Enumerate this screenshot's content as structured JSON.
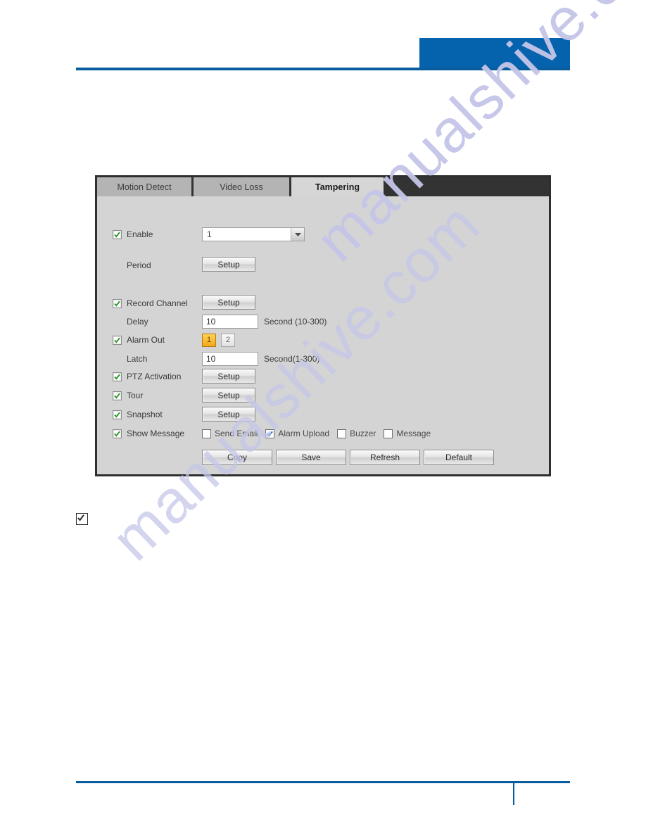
{
  "watermark": {
    "text": "manualshive.com"
  },
  "header": {
    "blue_block_color": "#0563ad",
    "rule_color": "#0a5d9c"
  },
  "footer": {
    "rule_color": "#0a5d9c"
  },
  "note": {
    "checkbox_icon": "checked-box-icon",
    "checked": true
  },
  "panel": {
    "background_color": "#d4d4d4",
    "border_color": "#2e2e2e",
    "tabs": [
      {
        "label": "Motion Detect",
        "active": false
      },
      {
        "label": "Video Loss",
        "active": false
      },
      {
        "label": "Tampering",
        "active": true
      }
    ],
    "rows": {
      "enable": {
        "label": "Enable",
        "checked": true,
        "select_value": "1",
        "select_arrow_icon": "chevron-down-icon"
      },
      "period": {
        "label": "Period",
        "button_label": "Setup"
      },
      "record_channel": {
        "label": "Record Channel",
        "checked": true,
        "button_label": "Setup"
      },
      "delay": {
        "label": "Delay",
        "value": "10",
        "unit": "Second (10-300)"
      },
      "alarm_out": {
        "label": "Alarm Out",
        "checked": true,
        "options": [
          {
            "label": "1",
            "selected": true
          },
          {
            "label": "2",
            "selected": false
          }
        ]
      },
      "latch": {
        "label": "Latch",
        "value": "10",
        "unit": "Second(1-300)"
      },
      "ptz_activation": {
        "label": "PTZ Activation",
        "checked": true,
        "button_label": "Setup"
      },
      "tour": {
        "label": "Tour",
        "checked": true,
        "button_label": "Setup"
      },
      "snapshot": {
        "label": "Snapshot",
        "checked": true,
        "button_label": "Setup"
      },
      "show_message": {
        "label": "Show Message",
        "checked": true,
        "options": [
          {
            "label": "Send Email",
            "checked": false
          },
          {
            "label": "Alarm Upload",
            "checked": true
          },
          {
            "label": "Buzzer",
            "checked": false
          },
          {
            "label": "Message",
            "checked": false
          }
        ]
      }
    },
    "actions": [
      {
        "label": "Copy"
      },
      {
        "label": "Save"
      },
      {
        "label": "Refresh"
      },
      {
        "label": "Default"
      }
    ]
  }
}
